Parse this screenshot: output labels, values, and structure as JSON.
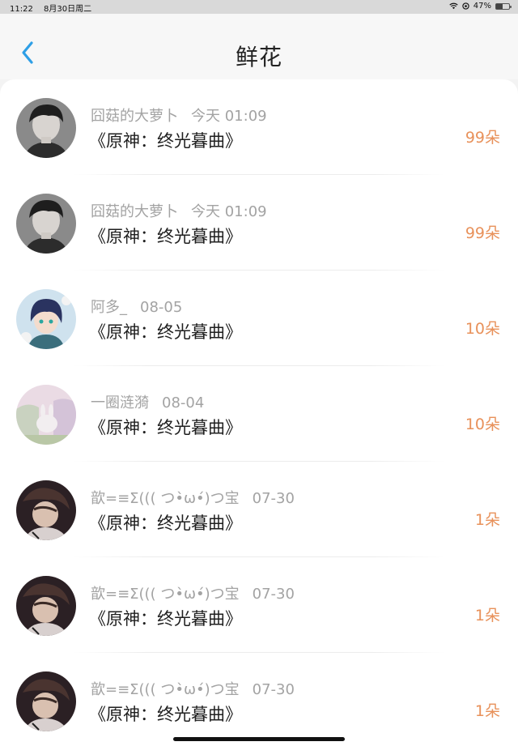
{
  "status_bar": {
    "time": "11:22",
    "date": "8月30日周二",
    "battery_text": "47%",
    "battery_level": 0.47
  },
  "header": {
    "title": "鲜花",
    "back_icon": "chevron-left-icon",
    "accent_color": "#2e9fe6"
  },
  "entries": [
    {
      "name": "囧菇的大萝卜",
      "time": "今天 01:09",
      "book": "《原神：终光暮曲》",
      "count": "99朵",
      "avatar": "boy-portrait"
    },
    {
      "name": "囧菇的大萝卜",
      "time": "今天 01:09",
      "book": "《原神：终光暮曲》",
      "count": "99朵",
      "avatar": "boy-portrait"
    },
    {
      "name": "阿多_",
      "time": "08-05",
      "book": "《原神：终光暮曲》",
      "count": "10朵",
      "avatar": "anime-character"
    },
    {
      "name": "一圈涟漪",
      "time": "08-04",
      "book": "《原神：终光暮曲》",
      "count": "10朵",
      "avatar": "pastel-painting"
    },
    {
      "name": "歆=≡Σ((( つ•̀ω•́)つ宝",
      "time": "07-30",
      "book": "《原神：终光暮曲》",
      "count": "1朵",
      "avatar": "dark-anime"
    },
    {
      "name": "歆=≡Σ((( つ•̀ω•́)つ宝",
      "time": "07-30",
      "book": "《原神：终光暮曲》",
      "count": "1朵",
      "avatar": "dark-anime"
    },
    {
      "name": "歆=≡Σ((( つ•̀ω•́)つ宝",
      "time": "07-30",
      "book": "《原神：终光暮曲》",
      "count": "1朵",
      "avatar": "dark-anime"
    }
  ],
  "colors": {
    "count": "#e8915a",
    "name": "#a3a3a3",
    "book": "#1f1f1f"
  }
}
